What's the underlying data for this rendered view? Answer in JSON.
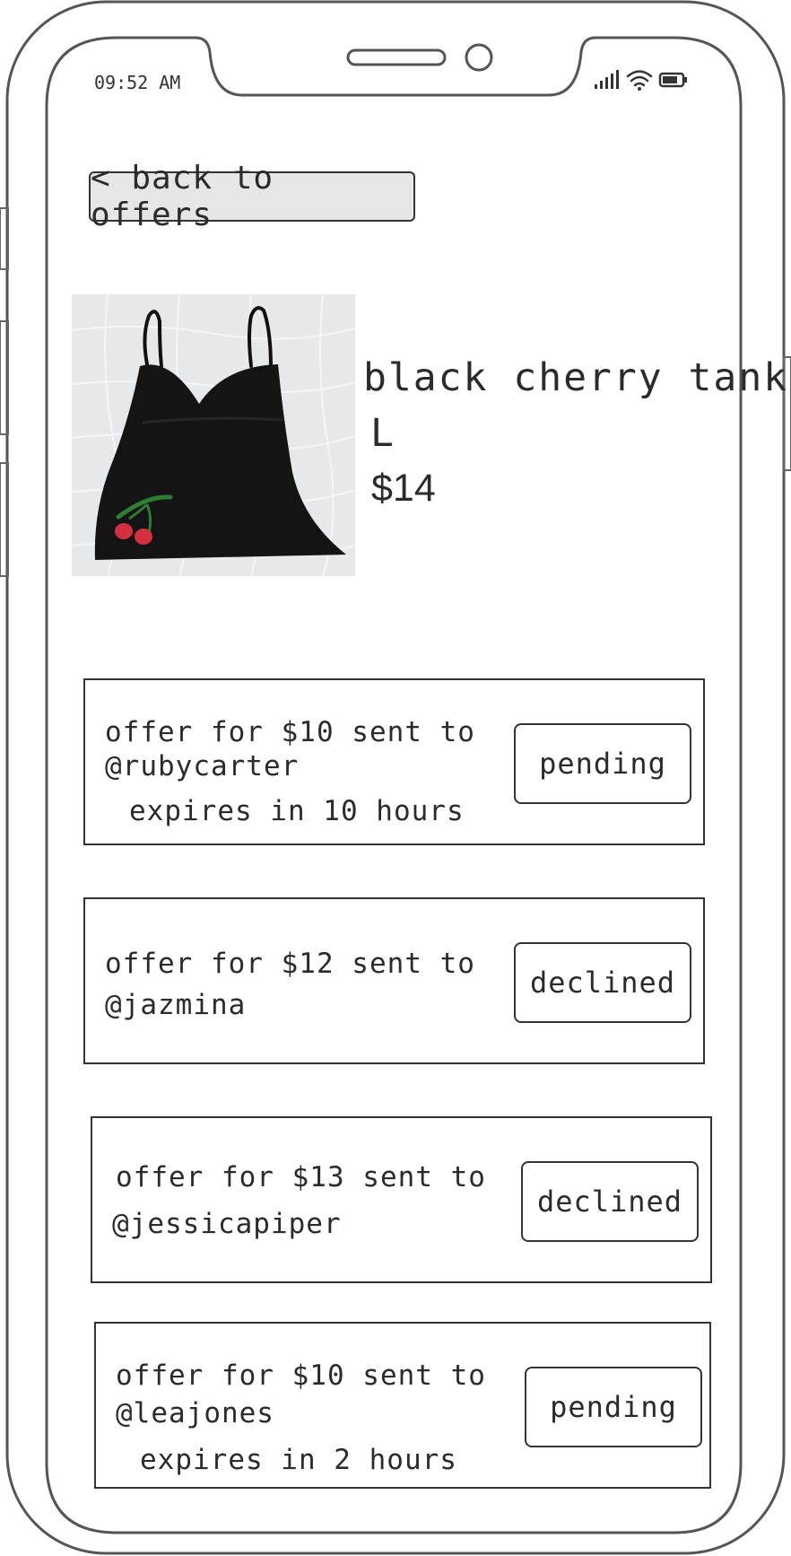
{
  "status_bar": {
    "time": "09:52 AM"
  },
  "back_button": {
    "label": "< back to offers"
  },
  "product": {
    "title": "black cherry tank",
    "size": "L",
    "price": "$14"
  },
  "offers": [
    {
      "line1": "offer for $10 sent to",
      "line2": "@rubycarter",
      "expires": "expires in 10 hours",
      "status": "pending"
    },
    {
      "line1": "offer for $12 sent to",
      "line2": "@jazmina",
      "expires": "",
      "status": "declined"
    },
    {
      "line1": "offer for $13 sent to",
      "line2": "@jessicapiper",
      "expires": "",
      "status": "declined"
    },
    {
      "line1": "offer for $10 sent to",
      "line2": "@leajones",
      "expires": "expires in 2 hours",
      "status": "pending"
    }
  ]
}
